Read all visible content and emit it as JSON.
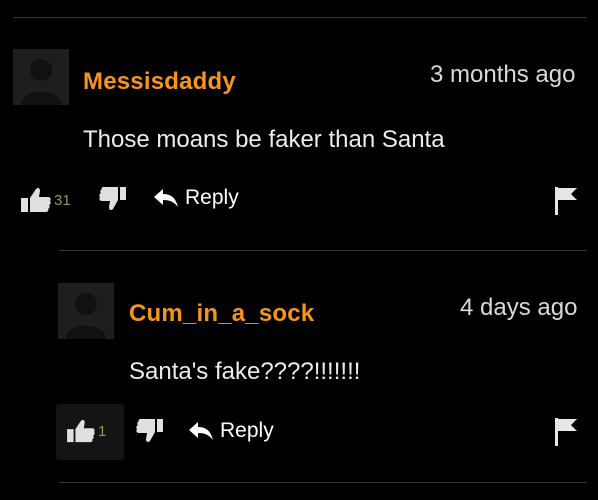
{
  "comments": [
    {
      "username": "Messisdaddy",
      "time": "3 months ago",
      "text": "Those moans be faker than Santa",
      "upvotes": "31",
      "reply_label": "Reply"
    },
    {
      "username": "Cum_in_a_sock",
      "time": "4 days ago",
      "text": "Santa's fake????!!!!!!!",
      "upvotes": "1",
      "reply_label": "Reply"
    }
  ],
  "colors": {
    "username": "#f7941e",
    "vote_count": "#8b9b4a",
    "background": "#000000"
  },
  "icons": [
    "avatar-placeholder-icon",
    "thumbs-up-icon",
    "thumbs-down-icon",
    "reply-arrow-icon",
    "flag-icon"
  ]
}
